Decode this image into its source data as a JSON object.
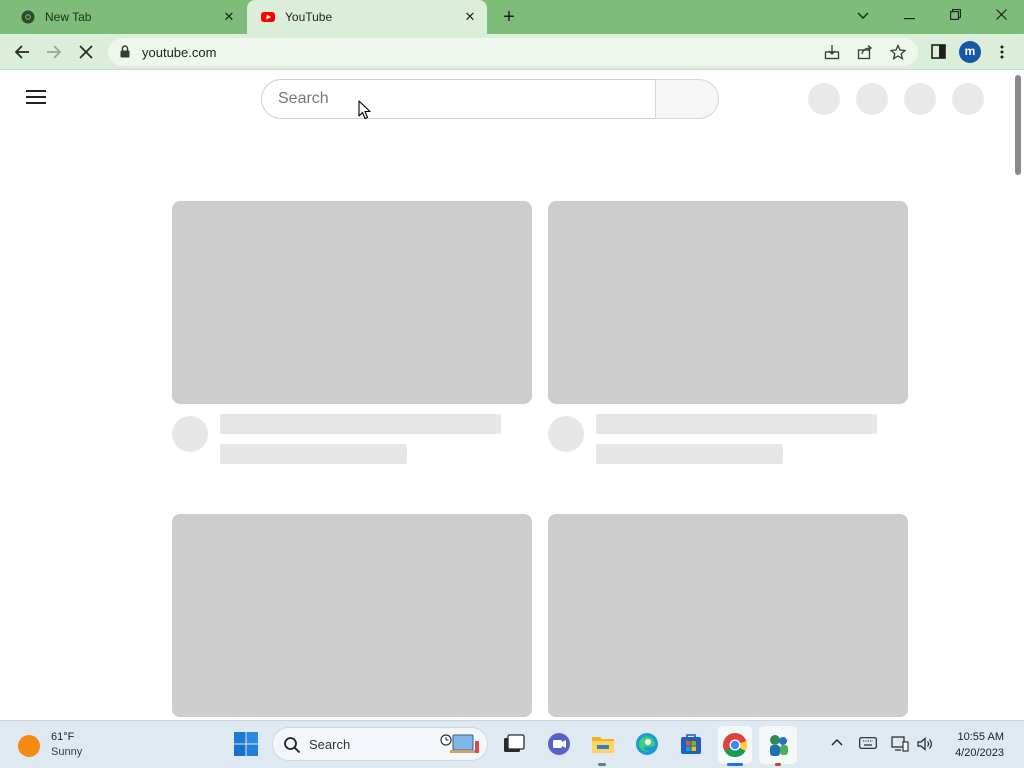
{
  "tabs": [
    {
      "title": "New Tab",
      "icon": "chrome-icon",
      "active": false
    },
    {
      "title": "YouTube",
      "icon": "youtube-icon",
      "active": true
    }
  ],
  "window_controls": {
    "dropdown": "⌄",
    "minimize": "—",
    "restore": "❐",
    "close": "✕"
  },
  "toolbar": {
    "back": "←",
    "forward": "→",
    "reload": "✕",
    "url": "youtube.com",
    "profile_initial": "m"
  },
  "page": {
    "search_placeholder": "Search"
  },
  "taskbar": {
    "weather_temp": "61°F",
    "weather_condition": "Sunny",
    "search_label": "Search",
    "time": "10:55 AM",
    "date": "4/20/2023"
  },
  "colors": {
    "tabstrip": "#7dbd79",
    "toolbar": "#dbeed9",
    "skeleton": "#cdcdcd",
    "skeleton_light": "#e6e6e6",
    "profile": "#1a56a8"
  }
}
